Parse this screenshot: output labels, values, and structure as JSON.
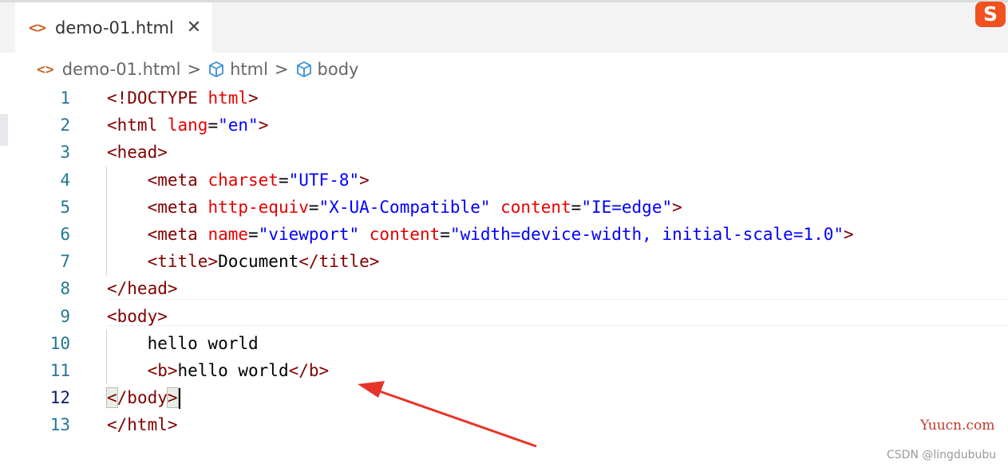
{
  "tab": {
    "label": "demo-01.html",
    "close": "✕"
  },
  "ime_icon": "S",
  "breadcrumb": {
    "file": "demo-01.html",
    "sep": ">",
    "item1": "html",
    "item2": "body"
  },
  "code_lines": [
    {
      "n": "1",
      "html": "<span class=\"t\">&lt;!DOCTYPE</span> <span class=\"a\">html</span><span class=\"t\">&gt;</span>"
    },
    {
      "n": "2",
      "html": "<span class=\"t\">&lt;html</span> <span class=\"a\">lang</span><span class=\"p\">=</span><span class=\"s\">\"en\"</span><span class=\"t\">&gt;</span>"
    },
    {
      "n": "3",
      "html": "<span class=\"t\">&lt;head&gt;</span>"
    },
    {
      "n": "4",
      "html": "    <span class=\"t\">&lt;meta</span> <span class=\"a\">charset</span><span class=\"p\">=</span><span class=\"s\">\"UTF-8\"</span><span class=\"t\">&gt;</span>"
    },
    {
      "n": "5",
      "html": "    <span class=\"t\">&lt;meta</span> <span class=\"a\">http-equiv</span><span class=\"p\">=</span><span class=\"s\">\"X-UA-Compatible\"</span> <span class=\"a\">content</span><span class=\"p\">=</span><span class=\"s\">\"IE=edge\"</span><span class=\"t\">&gt;</span>"
    },
    {
      "n": "6",
      "html": "    <span class=\"t\">&lt;meta</span> <span class=\"a\">name</span><span class=\"p\">=</span><span class=\"s\">\"viewport\"</span> <span class=\"a\">content</span><span class=\"p\">=</span><span class=\"s\">\"width=device-width, initial-scale=1.0\"</span><span class=\"t\">&gt;</span>"
    },
    {
      "n": "7",
      "html": "    <span class=\"t\">&lt;title&gt;</span><span class=\"p\">Document</span><span class=\"t\">&lt;/title&gt;</span>"
    },
    {
      "n": "8",
      "html": "<span class=\"t\">&lt;/head&gt;</span>"
    },
    {
      "n": "9",
      "html": "<span class=\"t\">&lt;body&gt;</span>"
    },
    {
      "n": "10",
      "html": "    <span class=\"p\">hello world</span>"
    },
    {
      "n": "11",
      "html": "    <span class=\"t\">&lt;b&gt;</span><span class=\"p\">hello world</span><span class=\"t\">&lt;/b&gt;</span>"
    },
    {
      "n": "12",
      "html": "<span class=\"t bracket-hl\">&lt;</span><span class=\"t\">/body</span><span class=\"t bracket-hl\">&gt;</span><span class=\"caret\"></span>",
      "active": true
    },
    {
      "n": "13",
      "html": "<span class=\"t\">&lt;/html&gt;</span>"
    }
  ],
  "watermark_site": "Yuucn.com",
  "watermark_csdn": "CSDN @lingdububu",
  "colors": {
    "tag": "#800000",
    "attr": "#e50000",
    "string": "#0000ff",
    "line_number": "#237893",
    "arrow": "#e8332a"
  },
  "icons": {
    "file_icon": "code-brackets-icon",
    "breadcrumb_icon": "cube-icon",
    "close": "close-icon"
  }
}
